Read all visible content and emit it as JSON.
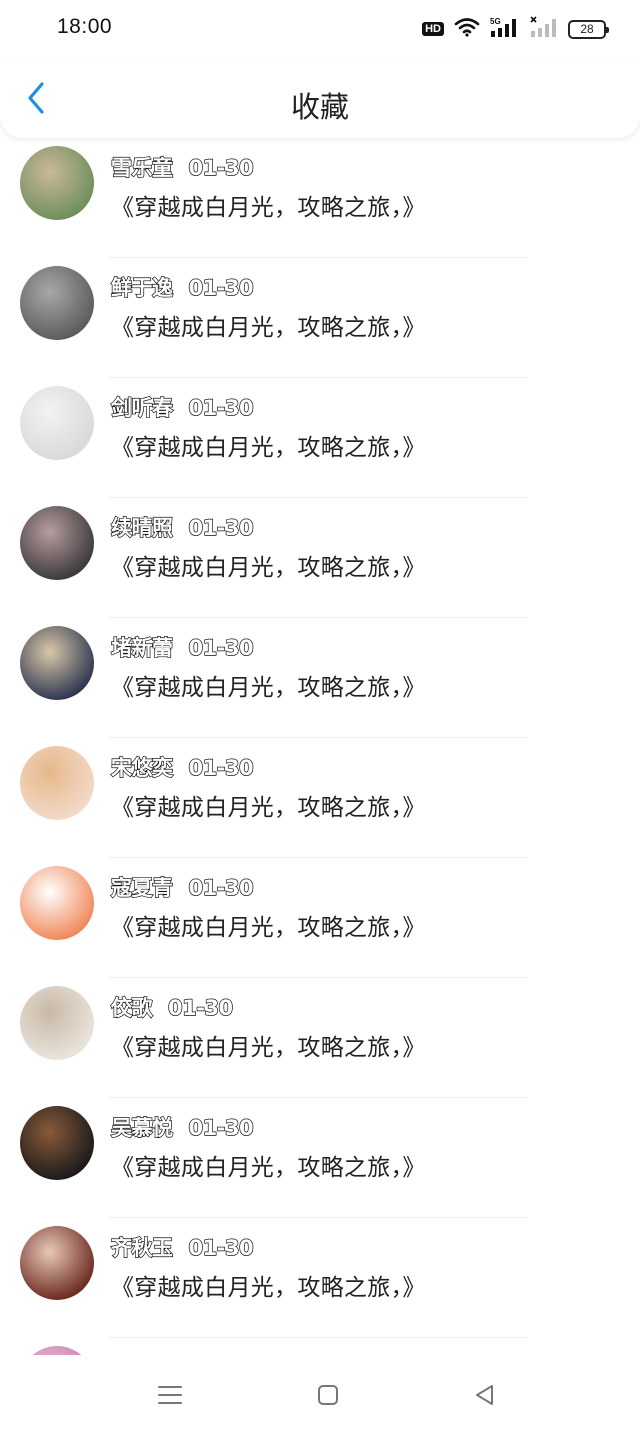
{
  "status_bar": {
    "time": "18:00",
    "hd_badge": "HD",
    "network": "5G",
    "battery": "28",
    "icons": [
      "hd-icon",
      "wifi-icon",
      "signal-5g-icon",
      "signal-icon",
      "battery-icon"
    ]
  },
  "header": {
    "title": "收藏",
    "back_icon": "chevron-left-icon"
  },
  "favorites": [
    {
      "name": "雪乐童",
      "date": "01-30",
      "text": "《穿越成白月光，攻略之旅，》",
      "avatar_colors": [
        "#6f8f5a",
        "#c9b89a"
      ]
    },
    {
      "name": "鲜于逸",
      "date": "01-30",
      "text": "《穿越成白月光，攻略之旅，》",
      "avatar_colors": [
        "#5c5c5c",
        "#a8a8a8"
      ]
    },
    {
      "name": "剑听春",
      "date": "01-30",
      "text": "《穿越成白月光，攻略之旅，》",
      "avatar_colors": [
        "#d9d9d9",
        "#f2f2f2"
      ]
    },
    {
      "name": "续晴照",
      "date": "01-30",
      "text": "《穿越成白月光，攻略之旅，》",
      "avatar_colors": [
        "#3a3a3a",
        "#b89ca0"
      ]
    },
    {
      "name": "堵新蕾",
      "date": "01-30",
      "text": "《穿越成白月光，攻略之旅，》",
      "avatar_colors": [
        "#2e3650",
        "#d9c8a8"
      ]
    },
    {
      "name": "宋悠奕",
      "date": "01-30",
      "text": "《穿越成白月光，攻略之旅，》",
      "avatar_colors": [
        "#f3d9c9",
        "#e6b88a"
      ]
    },
    {
      "name": "寇夏青",
      "date": "01-30",
      "text": "《穿越成白月光，攻略之旅，》",
      "avatar_colors": [
        "#f0885a",
        "#ffffff"
      ]
    },
    {
      "name": "佼歌",
      "date": "01-30",
      "text": "《穿越成白月光，攻略之旅，》",
      "avatar_colors": [
        "#e9e4dc",
        "#c9b9a6"
      ]
    },
    {
      "name": "吴慕悦",
      "date": "01-30",
      "text": "《穿越成白月光，攻略之旅，》",
      "avatar_colors": [
        "#1a1a1a",
        "#8a5a3a"
      ]
    },
    {
      "name": "齐秋玉",
      "date": "01-30",
      "text": "《穿越成白月光，攻略之旅，》",
      "avatar_colors": [
        "#6b2a20",
        "#e8c8b8"
      ]
    },
    {
      "name": "",
      "date": "",
      "text": "",
      "avatar_colors": [
        "#c878a8",
        "#e6c0d8"
      ]
    }
  ],
  "nav_bar": {
    "icons": [
      "menu-icon",
      "home-square-icon",
      "back-triangle-icon"
    ]
  },
  "colors": {
    "accent": "#1e8fe8",
    "text": "#222222",
    "divider": "#f0f0f0"
  }
}
